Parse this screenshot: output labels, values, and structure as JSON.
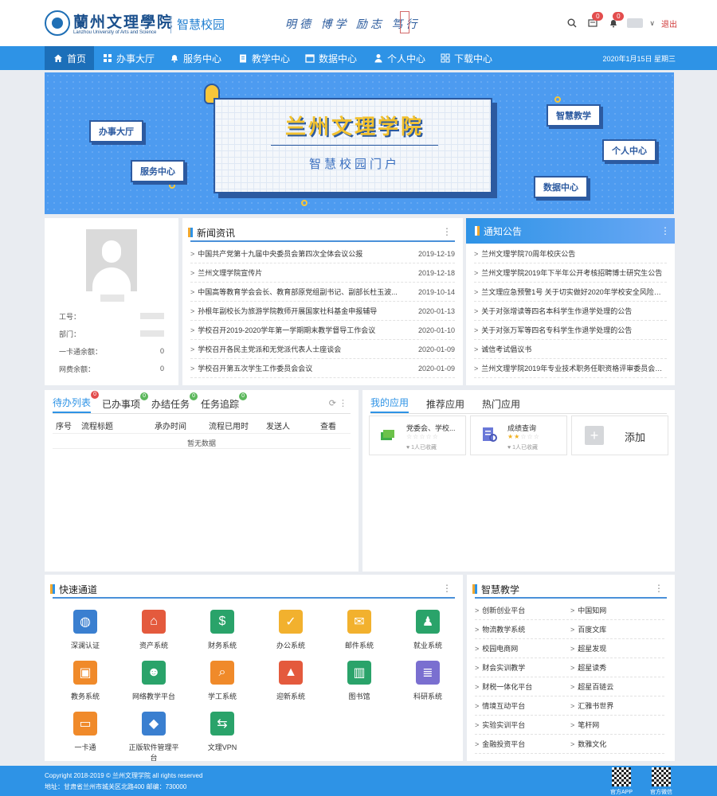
{
  "header": {
    "school_name": "蘭州文理學院",
    "school_name_en": "Lanzhou University of Arts and Science",
    "portal_title": "智慧校园",
    "motto": "明德 博学 励志 笃行",
    "notification_count": "0",
    "message_count": "0",
    "logout_label": "退出"
  },
  "nav": {
    "items": [
      {
        "label": "首页",
        "icon": "home-icon"
      },
      {
        "label": "办事大厅",
        "icon": "grid-icon"
      },
      {
        "label": "服务中心",
        "icon": "bell-icon"
      },
      {
        "label": "教学中心",
        "icon": "clipboard-icon"
      },
      {
        "label": "数据中心",
        "icon": "calendar-icon"
      },
      {
        "label": "个人中心",
        "icon": "person-icon"
      },
      {
        "label": "下载中心",
        "icon": "apps-icon"
      }
    ],
    "date": "2020年1月15日 星期三"
  },
  "banner": {
    "title": "兰州文理学院",
    "subtitle": "智慧校园门户",
    "bubbles": [
      "办事大厅",
      "服务中心",
      "智慧教学",
      "个人中心",
      "数据中心"
    ]
  },
  "profile": {
    "name_placeholder": "",
    "rows": [
      {
        "label": "工号：",
        "value": ""
      },
      {
        "label": "部门：",
        "value": ""
      },
      {
        "label": "一卡通余额：",
        "value": "0"
      },
      {
        "label": "网费余额：",
        "value": "0"
      }
    ]
  },
  "news": {
    "title": "新闻资讯",
    "items": [
      {
        "text": "中国共产党第十九届中央委员会第四次全体会议公报",
        "date": "2019-12-19"
      },
      {
        "text": "兰州文理学院宣传片",
        "date": "2019-12-18"
      },
      {
        "text": "中国高等教育学会会长、教育部原党组副书记、副部长杜玉波...",
        "date": "2019-10-14"
      },
      {
        "text": "孙根年副校长为旅游学院教师开展国家社科基金申报辅导",
        "date": "2020-01-13"
      },
      {
        "text": "学校召开2019-2020学年第一学期期末教学督导工作会议",
        "date": "2020-01-10"
      },
      {
        "text": "学校召开各民主党派和无党派代表人士座谈会",
        "date": "2020-01-09"
      },
      {
        "text": "学校召开第五次学生工作委员会会议",
        "date": "2020-01-09"
      }
    ]
  },
  "notices": {
    "title": "通知公告",
    "items": [
      "兰州文理学院70周年校庆公告",
      "兰州文理学院2019年下半年公开考核招聘博士研究生公告",
      "兰文理应急预警1号 关于切实做好2020年学校安全风险防...",
      "关于对张增读等四名本科学生作退学处理的公告",
      "关于对张万军等四名专科学生作退学处理的公告",
      "诚信考试倡议书",
      "兰州文理学院2019年专业技术职务任职资格评审委员会会..."
    ]
  },
  "tasks": {
    "tabs": [
      {
        "label": "待办列表",
        "badge": "0",
        "color": "#e34d4d"
      },
      {
        "label": "已办事项",
        "badge": "0",
        "color": "#5cb85c"
      },
      {
        "label": "办结任务",
        "badge": "0",
        "color": "#5cb85c"
      },
      {
        "label": "任务追踪",
        "badge": "0",
        "color": "#5cb85c"
      }
    ],
    "columns": [
      "序号",
      "流程标题",
      "承办时间",
      "流程已用时",
      "发送人",
      "查看"
    ],
    "empty": "暂无数据"
  },
  "apps": {
    "tabs": [
      "我的应用",
      "推荐应用",
      "热门应用"
    ],
    "tiles": [
      {
        "name": "党委会、学校...",
        "stars": 0,
        "fav": "1人已收藏"
      },
      {
        "name": "成绩查询",
        "stars": 2,
        "fav": "1人已收藏"
      }
    ],
    "add_label": "添加"
  },
  "quick": {
    "title": "快速通道",
    "items": [
      {
        "label": "深澜认证",
        "icon": "globe-icon",
        "color": "#3a7fd0"
      },
      {
        "label": "资产系统",
        "icon": "house-icon",
        "color": "#e45a3d"
      },
      {
        "label": "财务系统",
        "icon": "money-bag-icon",
        "color": "#2aa36a"
      },
      {
        "label": "办公系统",
        "icon": "document-icon",
        "color": "#f2b12e"
      },
      {
        "label": "邮件系统",
        "icon": "envelope-icon",
        "color": "#f2b12e"
      },
      {
        "label": "就业系统",
        "icon": "graduate-icon",
        "color": "#2aa36a"
      },
      {
        "label": "教务系统",
        "icon": "briefcase-icon",
        "color": "#f08a2a"
      },
      {
        "label": "网络教学平台",
        "icon": "teacher-icon",
        "color": "#2aa36a"
      },
      {
        "label": "学工系统",
        "icon": "search-doc-icon",
        "color": "#f08a2a"
      },
      {
        "label": "迎新系统",
        "icon": "cap-icon",
        "color": "#e45a3d"
      },
      {
        "label": "图书馆",
        "icon": "books-icon",
        "color": "#2aa36a"
      },
      {
        "label": "科研系统",
        "icon": "flask-icon",
        "color": "#7a6fd0"
      },
      {
        "label": "一卡通",
        "icon": "card-icon",
        "color": "#f08a2a"
      },
      {
        "label": "正版软件管理平台",
        "icon": "cube-icon",
        "color": "#3a7fd0"
      },
      {
        "label": "文理VPN",
        "icon": "vpn-icon",
        "color": "#2aa36a"
      }
    ]
  },
  "smart": {
    "title": "智慧教学",
    "left": [
      "创新创业平台",
      "物流教学系统",
      "校园电商网",
      "财会实训教学",
      "财税一体化平台",
      "情境互动平台",
      "实验实训平台",
      "金融投资平台"
    ],
    "right": [
      "中国知网",
      "百度文库",
      "超星发现",
      "超星读秀",
      "超星百链云",
      "汇雅书世界",
      "笔杆网",
      "数雅文化"
    ]
  },
  "footer": {
    "copyright": "Copyright 2018-2019 © 兰州文理学院 all rights reserved",
    "address": "地址：甘肃省兰州市城关区北路400    邮编：730000",
    "qr1": "官方APP",
    "qr2": "官方微信"
  }
}
